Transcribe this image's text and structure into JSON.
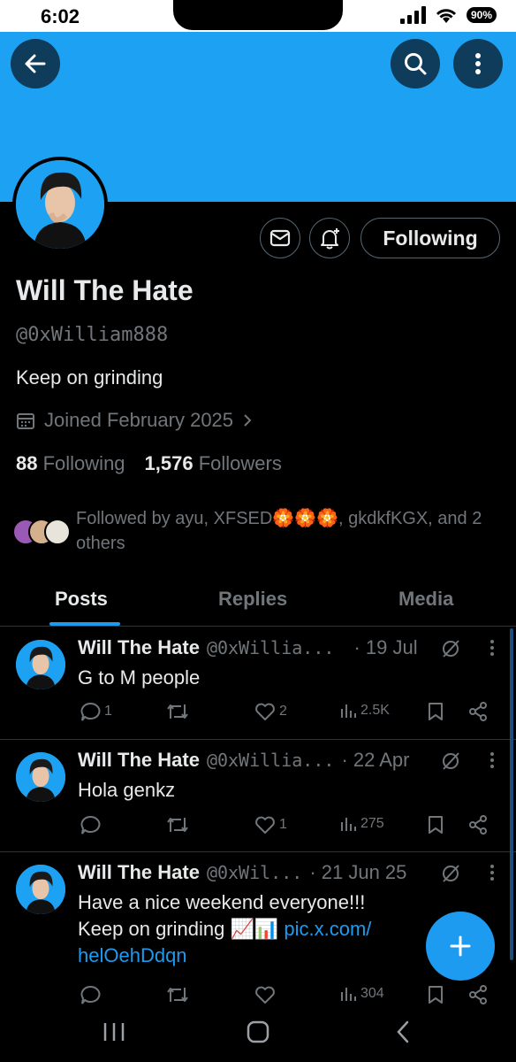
{
  "status_bar": {
    "time": "6:02",
    "battery": "90%"
  },
  "profile": {
    "name": "Will The Hate",
    "handle": "@0xWilliam888",
    "bio": "Keep on grinding",
    "joined": "Joined February 2025",
    "following_count": "88",
    "following_label": "Following",
    "followers_count": "1,576",
    "followers_label": "Followers",
    "followed_by": "Followed by ayu, XFSED🏵️🏵️🏵️, gkdkfKGX, and 2 others",
    "follow_button": "Following"
  },
  "tabs": [
    {
      "label": "Posts",
      "active": true
    },
    {
      "label": "Replies",
      "active": false
    },
    {
      "label": "Media",
      "active": false
    }
  ],
  "posts": [
    {
      "name": "Will The Hate",
      "handle": "@0xWillia...",
      "date": "· 19 Jul",
      "text": "G to M people",
      "replies": "1",
      "reposts": "",
      "likes": "2",
      "views": "2.5K"
    },
    {
      "name": "Will The Hate",
      "handle": "@0xWillia...",
      "date": "· 22 Apr",
      "text": "Hola genkz",
      "replies": "",
      "reposts": "",
      "likes": "1",
      "views": "275"
    },
    {
      "name": "Will The Hate",
      "handle": "@0xWil...",
      "date": "· 21 Jun 25",
      "text_line1": "Have a nice weekend everyone!!!",
      "text_line2": "Keep on grinding 📈📊",
      "link_part1": "pic.x.com/",
      "link_part2": "helOehDdqn",
      "replies": "",
      "reposts": "",
      "likes": "",
      "views": "304"
    }
  ],
  "colors": {
    "banner": "#1da1f2",
    "accent": "#1d9bf0",
    "muted": "#71767b",
    "background": "#000000"
  }
}
